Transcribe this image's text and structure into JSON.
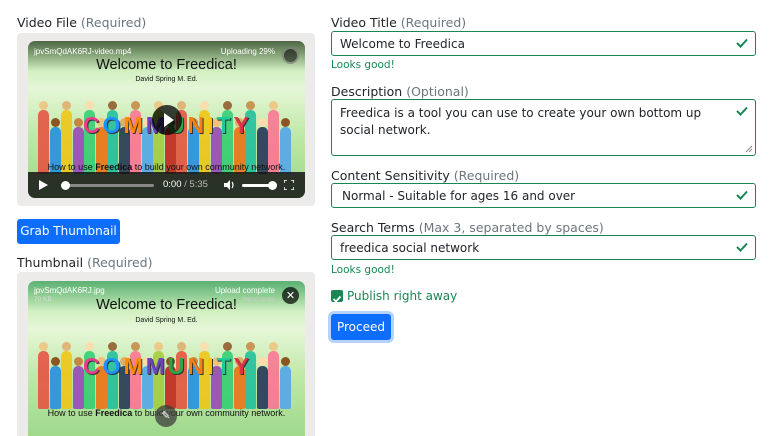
{
  "video_file": {
    "label": "Video File",
    "required_note": "(Required)",
    "filename": "jpvSmQdAK6RJ-video.mp4",
    "status": "Uploading 29%",
    "progress_percent": 29,
    "poster_title": "Welcome to Freedica!",
    "poster_author": "David Spring M. Ed.",
    "poster_word": [
      "C",
      "O",
      "M",
      "M",
      "U",
      "N",
      "I",
      "T",
      "Y"
    ],
    "caption_pre": "How to use ",
    "caption_bold": "Freedica",
    "caption_post": " to build your own community network.",
    "player": {
      "current_time": "0:00",
      "separator": "/",
      "duration": "5:35"
    }
  },
  "grab_thumbnail_button": "Grab Thumbnail",
  "thumbnail": {
    "label": "Thumbnail",
    "required_note": "(Required)",
    "filename": "jpvSmQdAK6RJ.jpg",
    "filesize": "70 KB",
    "status": "Upload complete",
    "undo_hint": "tap to undo",
    "poster_title": "Welcome to Freedica!",
    "poster_author": "David Spring M. Ed.",
    "poster_word": [
      "C",
      "O",
      "M",
      "M",
      "U",
      "N",
      "I",
      "T",
      "Y"
    ],
    "caption_pre": "How to use ",
    "caption_bold": "Freedica",
    "caption_post": " to build your own community network."
  },
  "video_title": {
    "label": "Video Title",
    "note": "(Required)",
    "value": "Welcome to Freedica",
    "feedback": "Looks good!"
  },
  "description": {
    "label": "Description",
    "note": "(Optional)",
    "value": "Freedica is a tool you can use to create your own bottom up social network."
  },
  "content_sensitivity": {
    "label": "Content Sensitivity",
    "note": "(Required)",
    "selected": "Normal - Suitable for ages 16 and over"
  },
  "search_terms": {
    "label": "Search Terms",
    "note": "(Max 3, separated by spaces)",
    "value": "freedica social network",
    "feedback": "Looks good!"
  },
  "publish": {
    "label": "Publish right away",
    "checked": true
  },
  "proceed_button": "Proceed",
  "colors": {
    "valid": "#198754",
    "primary": "#0d6efd",
    "panel": "#ecebea"
  }
}
